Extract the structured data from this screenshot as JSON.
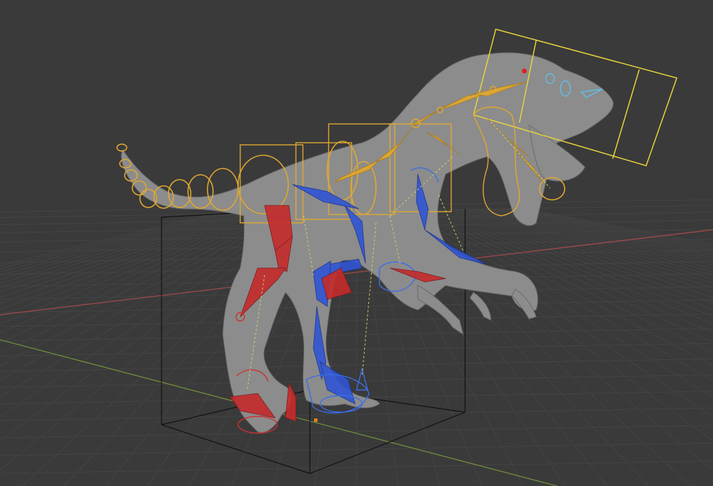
{
  "viewport": {
    "background": "#3a3a3a",
    "grid_color": "#444444",
    "x_axis_color": "#a34a4a",
    "y_axis_color": "#6e8f3a"
  },
  "rig": {
    "mesh_color": "#8a8a8a",
    "bone_colors": {
      "center": "#e0a830",
      "left": "#2f55d4",
      "right": "#c42b2b",
      "widget_yellow": "#e8d43a",
      "bounding_box": "#111111"
    }
  }
}
